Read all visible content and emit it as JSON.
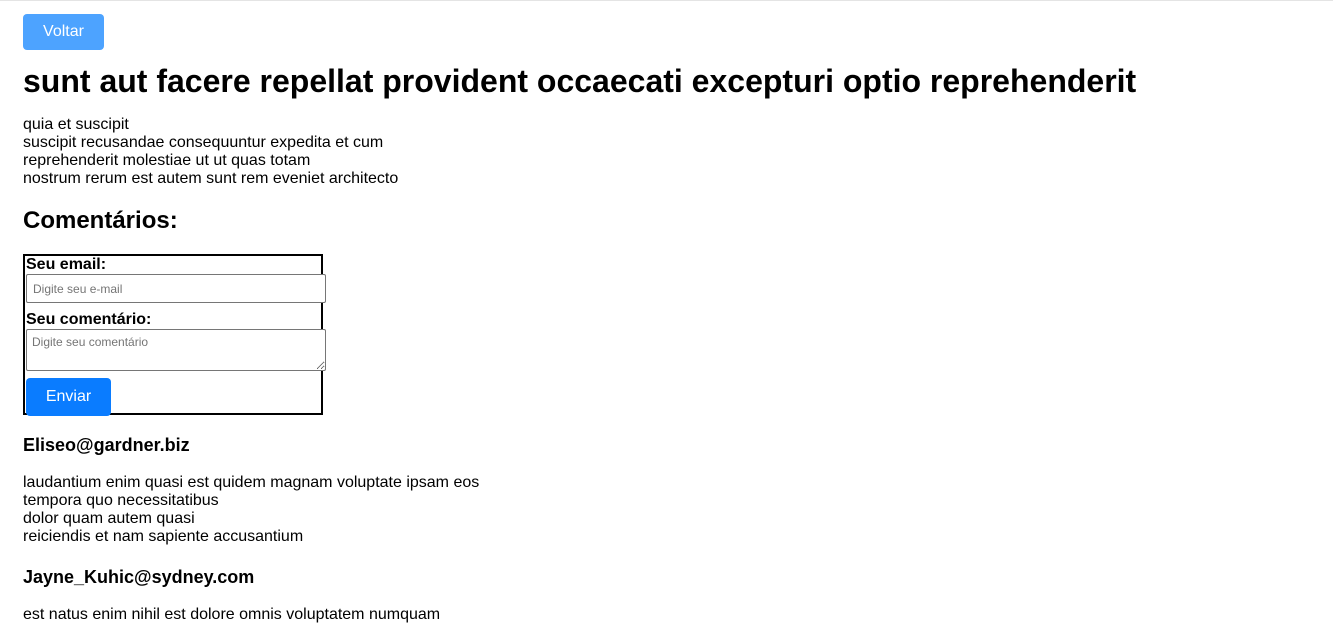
{
  "nav": {
    "back_label": "Voltar"
  },
  "post": {
    "title": "sunt aut facere repellat provident occaecati excepturi optio reprehenderit",
    "body_lines": [
      "quia et suscipit",
      "suscipit recusandae consequuntur expedita et cum",
      "reprehenderit molestiae ut ut quas totam",
      "nostrum rerum est autem sunt rem eveniet architecto"
    ]
  },
  "comments_section": {
    "heading": "Comentários:",
    "form": {
      "email_label": "Seu email:",
      "email_placeholder": "Digite seu e-mail",
      "email_value": "",
      "comment_label": "Seu comentário:",
      "comment_placeholder": "Digite seu comentário",
      "comment_value": "",
      "submit_label": "Enviar"
    },
    "comments": [
      {
        "email": "Eliseo@gardner.biz",
        "body_lines": [
          "laudantium enim quasi est quidem magnam voluptate ipsam eos",
          "tempora quo necessitatibus",
          "dolor quam autem quasi",
          "reiciendis et nam sapiente accusantium"
        ]
      },
      {
        "email": "Jayne_Kuhic@sydney.com",
        "body_lines": [
          "est natus enim nihil est dolore omnis voluptatem numquam"
        ]
      }
    ]
  }
}
